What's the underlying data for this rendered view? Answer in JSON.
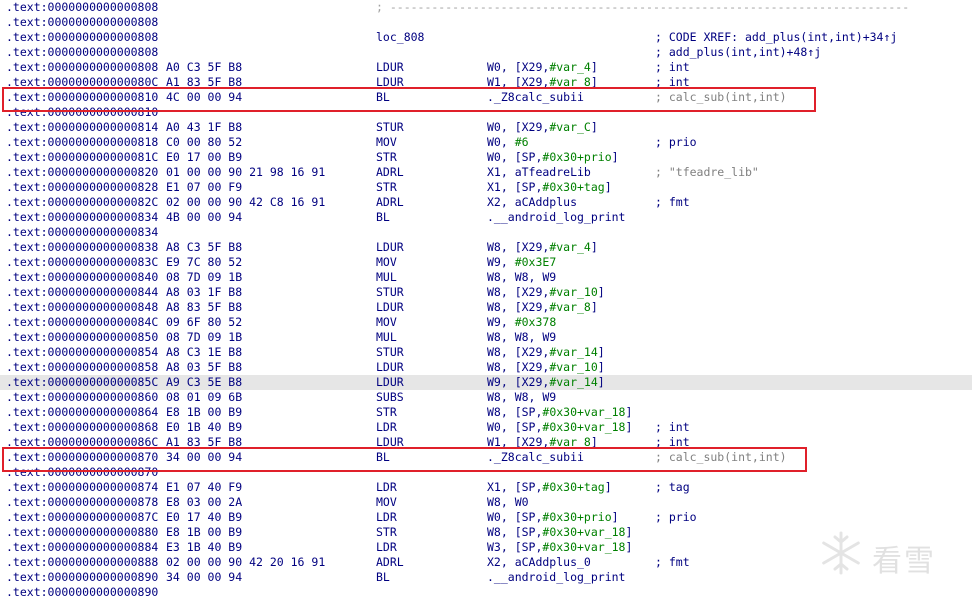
{
  "separator": "; ---------------------------------------------------------------------------",
  "rows": [
    {
      "addr": ".text:0000000000000808",
      "bytes": "",
      "mnem": "",
      "ops": "",
      "cmt": "",
      "sep": true
    },
    {
      "addr": ".text:0000000000000808",
      "bytes": "",
      "mnem": "",
      "ops": "",
      "cmt": ""
    },
    {
      "addr": ".text:0000000000000808",
      "bytes": "",
      "mnem": "loc_808",
      "ops": "",
      "cmt": "; CODE XREF: add_plus(int,int)+34↑j"
    },
    {
      "addr": ".text:0000000000000808",
      "bytes": "",
      "mnem": "",
      "ops": "",
      "cmt": "; add_plus(int,int)+48↑j"
    },
    {
      "addr": ".text:0000000000000808",
      "bytes": "A0 C3 5F B8",
      "mnem": "LDUR",
      "ops": "W0, [X29,#var_4]",
      "cmt": "; int"
    },
    {
      "addr": ".text:000000000000080C",
      "bytes": "A1 83 5F B8",
      "mnem": "LDUR",
      "ops": "W1, [X29,#var_8]",
      "cmt": "; int"
    },
    {
      "addr": ".text:0000000000000810",
      "bytes": "4C 00 00 94",
      "mnem": "BL",
      "ops": "._Z8calc_subii",
      "cmt": "; calc_sub(int,int)",
      "box": "b1"
    },
    {
      "addr": ".text:0000000000000810",
      "bytes": "",
      "mnem": "",
      "ops": "",
      "cmt": ""
    },
    {
      "addr": ".text:0000000000000814",
      "bytes": "A0 43 1F B8",
      "mnem": "STUR",
      "ops": "W0, [X29,#var_C]",
      "cmt": ""
    },
    {
      "addr": ".text:0000000000000818",
      "bytes": "C0 00 80 52",
      "mnem": "MOV",
      "ops": "W0, #6",
      "cmt": "; prio"
    },
    {
      "addr": ".text:000000000000081C",
      "bytes": "E0 17 00 B9",
      "mnem": "STR",
      "ops": "W0, [SP,#0x30+prio]",
      "cmt": ""
    },
    {
      "addr": ".text:0000000000000820",
      "bytes": "01 00 00 90 21 98 16 91",
      "mnem": "ADRL",
      "ops": "X1, aTfeadreLib",
      "cmt": "; \"tfeadre_lib\"",
      "cmtGray": true
    },
    {
      "addr": ".text:0000000000000828",
      "bytes": "E1 07 00 F9",
      "mnem": "STR",
      "ops": "X1, [SP,#0x30+tag]",
      "cmt": ""
    },
    {
      "addr": ".text:000000000000082C",
      "bytes": "02 00 00 90 42 C8 16 91",
      "mnem": "ADRL",
      "ops": "X2, aCAddplus",
      "cmt": "; fmt"
    },
    {
      "addr": ".text:0000000000000834",
      "bytes": "4B 00 00 94",
      "mnem": "BL",
      "ops": ".__android_log_print",
      "cmt": ""
    },
    {
      "addr": ".text:0000000000000834",
      "bytes": "",
      "mnem": "",
      "ops": "",
      "cmt": ""
    },
    {
      "addr": ".text:0000000000000838",
      "bytes": "A8 C3 5F B8",
      "mnem": "LDUR",
      "ops": "W8, [X29,#var_4]",
      "cmt": ""
    },
    {
      "addr": ".text:000000000000083C",
      "bytes": "E9 7C 80 52",
      "mnem": "MOV",
      "ops": "W9, #0x3E7",
      "cmt": ""
    },
    {
      "addr": ".text:0000000000000840",
      "bytes": "08 7D 09 1B",
      "mnem": "MUL",
      "ops": "W8, W8, W9",
      "cmt": ""
    },
    {
      "addr": ".text:0000000000000844",
      "bytes": "A8 03 1F B8",
      "mnem": "STUR",
      "ops": "W8, [X29,#var_10]",
      "cmt": ""
    },
    {
      "addr": ".text:0000000000000848",
      "bytes": "A8 83 5F B8",
      "mnem": "LDUR",
      "ops": "W8, [X29,#var_8]",
      "cmt": ""
    },
    {
      "addr": ".text:000000000000084C",
      "bytes": "09 6F 80 52",
      "mnem": "MOV",
      "ops": "W9, #0x378",
      "cmt": ""
    },
    {
      "addr": ".text:0000000000000850",
      "bytes": "08 7D 09 1B",
      "mnem": "MUL",
      "ops": "W8, W8, W9",
      "cmt": ""
    },
    {
      "addr": ".text:0000000000000854",
      "bytes": "A8 C3 1E B8",
      "mnem": "STUR",
      "ops": "W8, [X29,#var_14]",
      "cmt": ""
    },
    {
      "addr": ".text:0000000000000858",
      "bytes": "A8 03 5F B8",
      "mnem": "LDUR",
      "ops": "W8, [X29,#var_10]",
      "cmt": ""
    },
    {
      "addr": ".text:000000000000085C",
      "bytes": "A9 C3 5E B8",
      "mnem": "LDUR",
      "ops": "W9, [X29,#var_14]",
      "cmt": "",
      "hl": true
    },
    {
      "addr": ".text:0000000000000860",
      "bytes": "08 01 09 6B",
      "mnem": "SUBS",
      "ops": "W8, W8, W9",
      "cmt": ""
    },
    {
      "addr": ".text:0000000000000864",
      "bytes": "E8 1B 00 B9",
      "mnem": "STR",
      "ops": "W8, [SP,#0x30+var_18]",
      "cmt": ""
    },
    {
      "addr": ".text:0000000000000868",
      "bytes": "E0 1B 40 B9",
      "mnem": "LDR",
      "ops": "W0, [SP,#0x30+var_18]",
      "cmt": "; int"
    },
    {
      "addr": ".text:000000000000086C",
      "bytes": "A1 83 5F B8",
      "mnem": "LDUR",
      "ops": "W1, [X29,#var_8]",
      "cmt": "; int"
    },
    {
      "addr": ".text:0000000000000870",
      "bytes": "34 00 00 94",
      "mnem": "BL",
      "ops": "._Z8calc_subii",
      "cmt": "; calc_sub(int,int)",
      "box": "b2"
    },
    {
      "addr": ".text:0000000000000870",
      "bytes": "",
      "mnem": "",
      "ops": "",
      "cmt": ""
    },
    {
      "addr": ".text:0000000000000874",
      "bytes": "E1 07 40 F9",
      "mnem": "LDR",
      "ops": "X1, [SP,#0x30+tag]",
      "cmt": "; tag"
    },
    {
      "addr": ".text:0000000000000878",
      "bytes": "E8 03 00 2A",
      "mnem": "MOV",
      "ops": "W8, W0",
      "cmt": ""
    },
    {
      "addr": ".text:000000000000087C",
      "bytes": "E0 17 40 B9",
      "mnem": "LDR",
      "ops": "W0, [SP,#0x30+prio]",
      "cmt": "; prio"
    },
    {
      "addr": ".text:0000000000000880",
      "bytes": "E8 1B 00 B9",
      "mnem": "STR",
      "ops": "W8, [SP,#0x30+var_18]",
      "cmt": ""
    },
    {
      "addr": ".text:0000000000000884",
      "bytes": "E3 1B 40 B9",
      "mnem": "LDR",
      "ops": "W3, [SP,#0x30+var_18]",
      "cmt": ""
    },
    {
      "addr": ".text:0000000000000888",
      "bytes": "02 00 00 90 42 20 16 91",
      "mnem": "ADRL",
      "ops": "X2, aCAddplus_0",
      "cmt": "; fmt"
    },
    {
      "addr": ".text:0000000000000890",
      "bytes": "34 00 00 94",
      "mnem": "BL",
      "ops": ".__android_log_print",
      "cmt": ""
    },
    {
      "addr": ".text:0000000000000890",
      "bytes": "",
      "mnem": "",
      "ops": "",
      "cmt": ""
    }
  ],
  "watermark": {
    "text": "看雪",
    "icon": "snowflake-icon"
  }
}
